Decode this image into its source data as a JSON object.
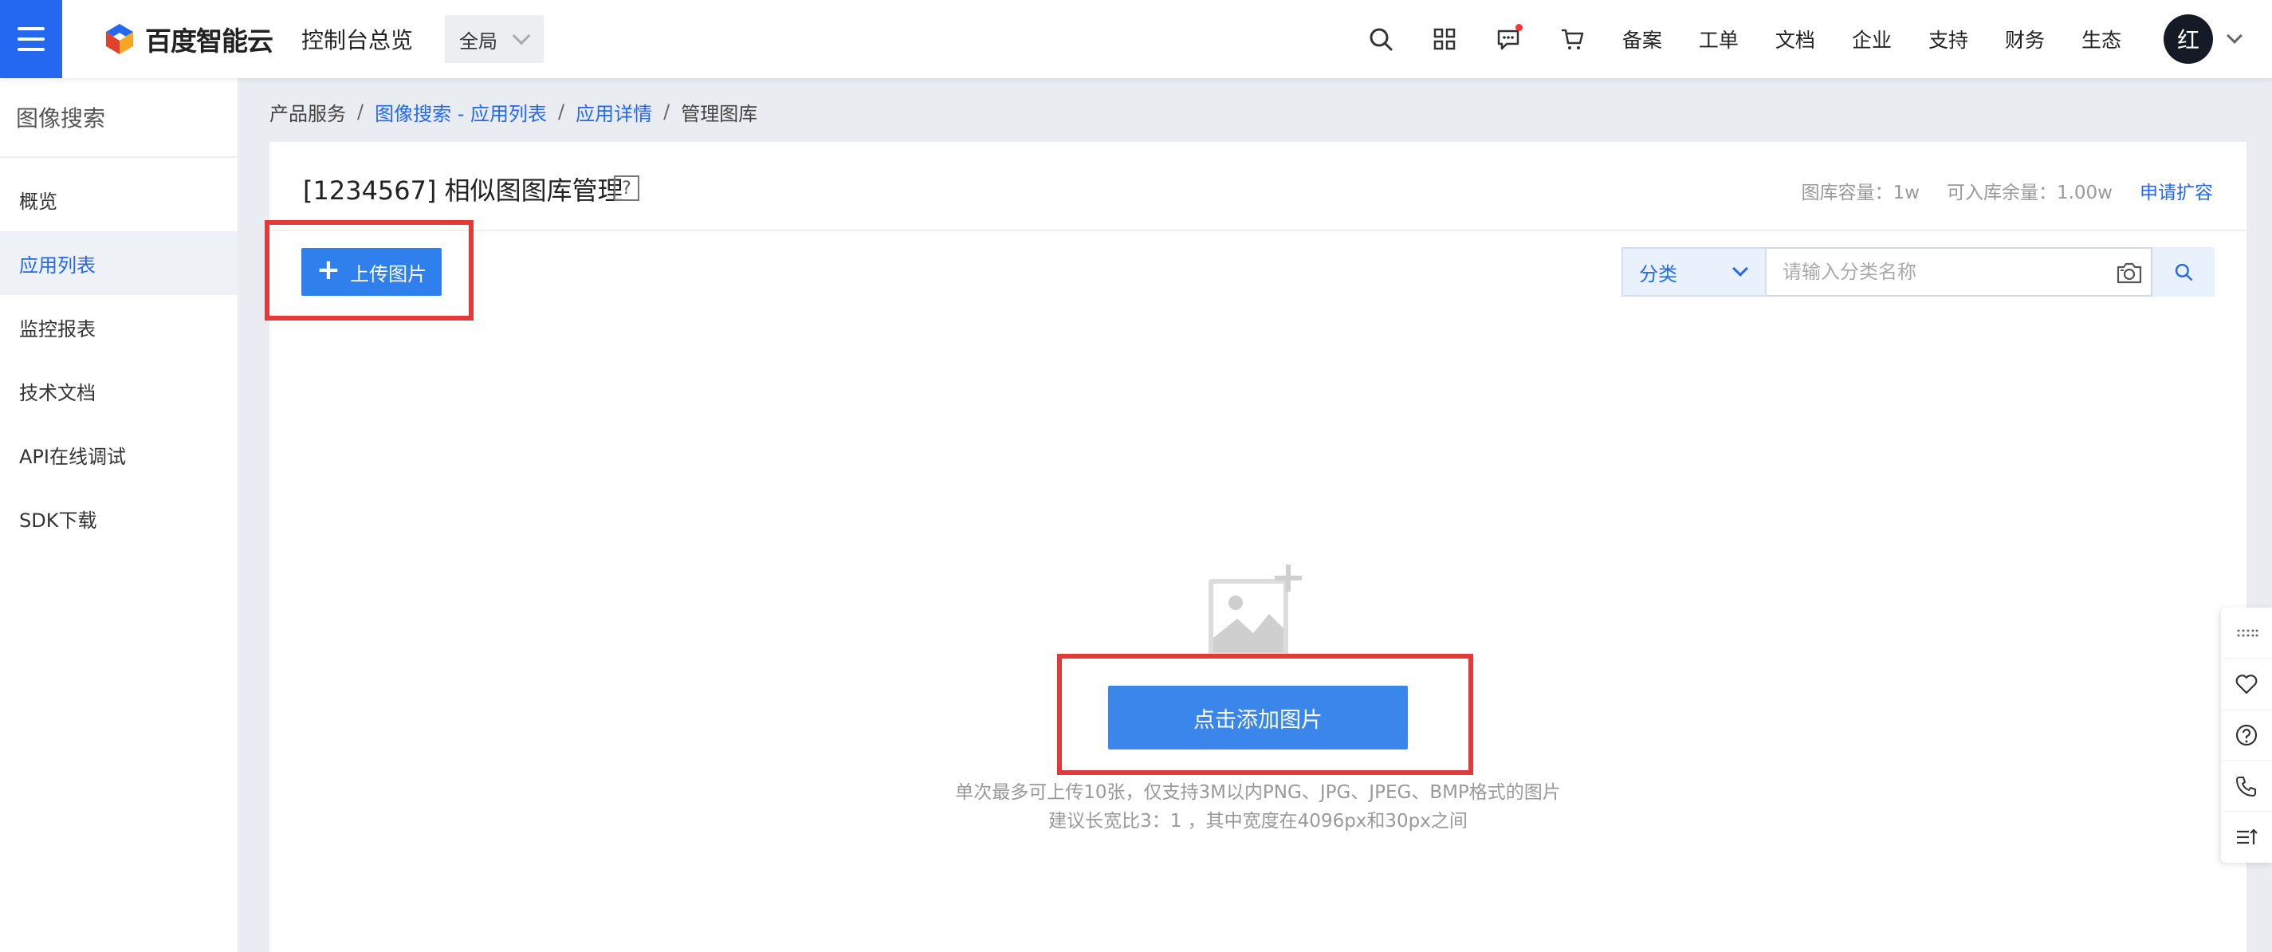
{
  "topbar": {
    "brand": "百度智能云",
    "console_title": "控制台总览",
    "scope": "全局",
    "nav": [
      "备案",
      "工单",
      "文档",
      "企业",
      "支持",
      "财务",
      "生态"
    ],
    "avatar": "红"
  },
  "sidebar": {
    "title": "图像搜索",
    "items": [
      "概览",
      "应用列表",
      "监控报表",
      "技术文档",
      "API在线调试",
      "SDK下载"
    ],
    "active_index": 1
  },
  "breadcrumb": {
    "root": "产品服务",
    "level1": "图像搜索 - 应用列表",
    "level2": "应用详情",
    "current": "管理图库",
    "separator": "/"
  },
  "page": {
    "title": "[1234567] 相似图图库管理",
    "help": "?",
    "capacity_label": "图库容量：1w",
    "remaining_label": "可入库余量：1.00w",
    "expand_link": "申请扩容",
    "upload_button": "上传图片",
    "category_select": "分类",
    "search_placeholder": "请输入分类名称",
    "add_image_button": "点击添加图片",
    "hint_line1": "单次最多可上传10张，仅支持3M以内PNG、JPG、JPEG、BMP格式的图片",
    "hint_line2": "建议长宽比3：1 ，其中宽度在4096px和30px之间"
  },
  "colors": {
    "primary": "#2468f2",
    "button": "#2f80ed",
    "highlight": "#e23a3a"
  }
}
